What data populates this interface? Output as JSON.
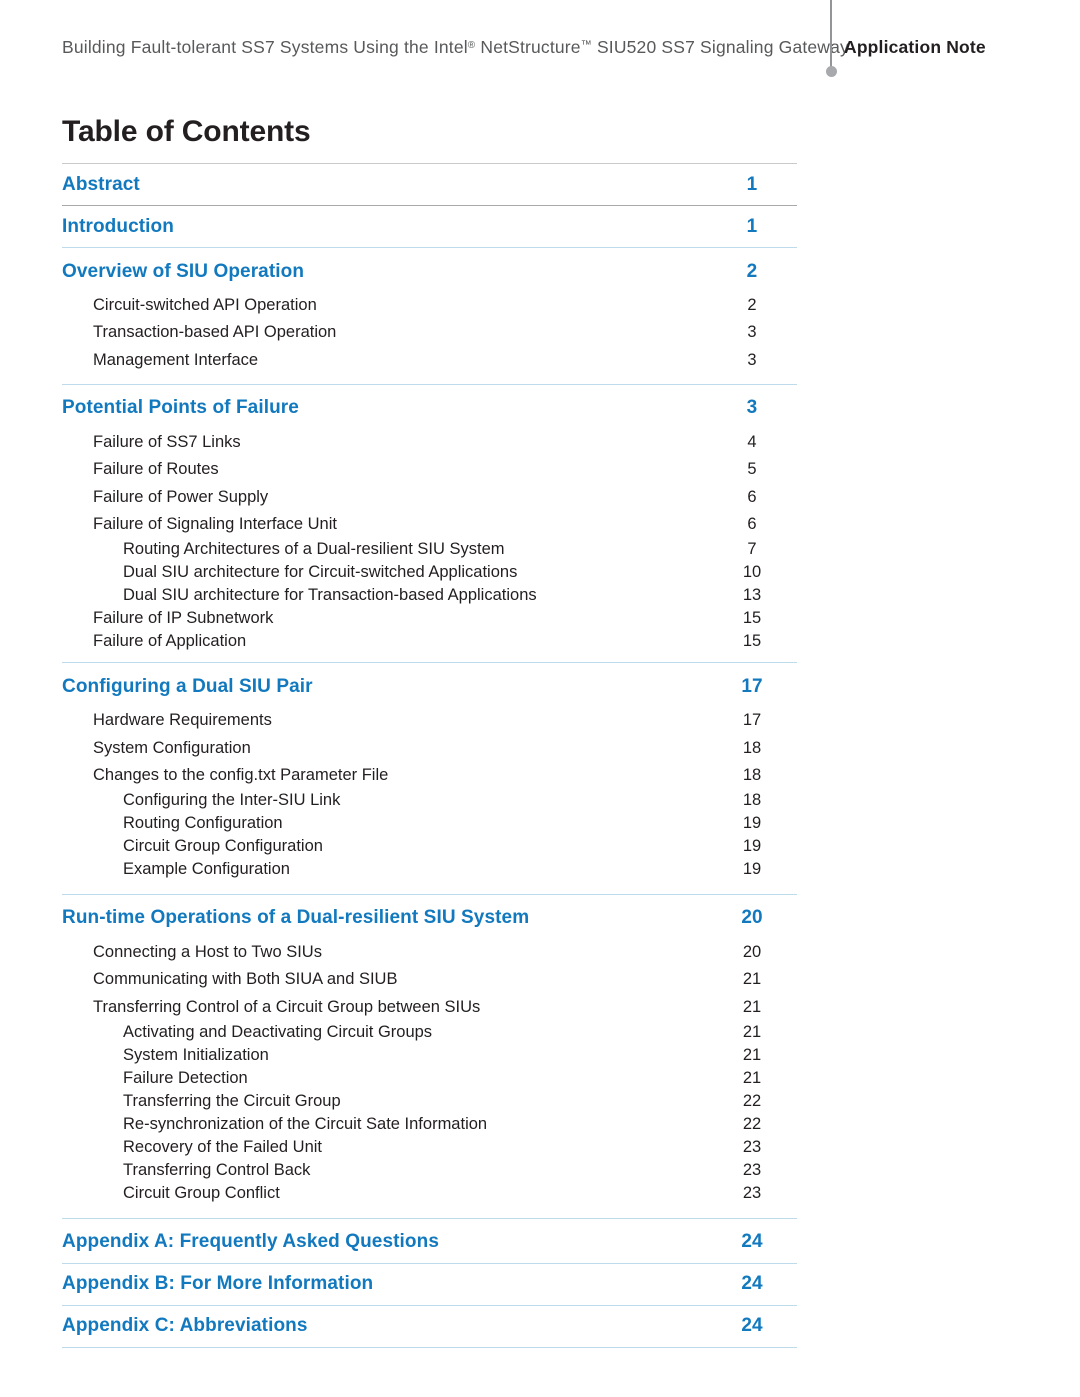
{
  "header": {
    "title_before_reg": "Building Fault-tolerant SS7 Systems Using the Intel",
    "reg_symbol": "®",
    "title_after_reg": " NetStructure",
    "tm_symbol": "™",
    "title_tail": " SIU520 SS7 Signaling Gateway",
    "kicker": "Application Note"
  },
  "page_title": "Table of Contents",
  "colors": {
    "heading_blue": "#1279be",
    "body_black": "#231f20",
    "rule_gray": "#a7a9ac",
    "rule_blue": "#bcdcec",
    "header_gray": "#58595b"
  },
  "toc": {
    "entries": [
      {
        "level": 1,
        "label": "Abstract",
        "page": "1"
      },
      {
        "level": 1,
        "label": "Introduction",
        "page": "1"
      },
      {
        "level": 1,
        "label": "Overview of SIU Operation",
        "page": "2"
      },
      {
        "level": 2,
        "label": "Circuit-switched API Operation",
        "page": "2"
      },
      {
        "level": 2,
        "label": "Transaction-based API Operation",
        "page": "3"
      },
      {
        "level": 2,
        "label": "Management Interface",
        "page": "3"
      },
      {
        "level": 1,
        "label": "Potential Points of Failure",
        "page": "3"
      },
      {
        "level": 2,
        "label": "Failure of SS7 Links",
        "page": "4"
      },
      {
        "level": 2,
        "label": "Failure of Routes",
        "page": "5"
      },
      {
        "level": 2,
        "label": "Failure of Power Supply",
        "page": "6"
      },
      {
        "level": 2,
        "label": "Failure of Signaling Interface Unit",
        "page": "6"
      },
      {
        "level": 3,
        "label": "Routing Architectures of a Dual-resilient SIU System",
        "page": "7"
      },
      {
        "level": 3,
        "label": "Dual SIU architecture for Circuit-switched Applications",
        "page": "10"
      },
      {
        "level": 3,
        "label": "Dual SIU architecture for Transaction-based Applications",
        "page": "13"
      },
      {
        "level": 2,
        "label": "Failure of IP Subnetwork",
        "page": "15"
      },
      {
        "level": 2,
        "label": "Failure of Application",
        "page": "15"
      },
      {
        "level": 1,
        "label": "Configuring a Dual SIU Pair",
        "page": "17"
      },
      {
        "level": 2,
        "label": "Hardware Requirements",
        "page": "17"
      },
      {
        "level": 2,
        "label": "System Configuration",
        "page": "18"
      },
      {
        "level": 2,
        "label": "Changes to the config.txt Parameter File",
        "page": "18"
      },
      {
        "level": 3,
        "label": "Configuring the Inter-SIU Link",
        "page": "18"
      },
      {
        "level": 3,
        "label": "Routing Configuration",
        "page": "19"
      },
      {
        "level": 3,
        "label": "Circuit Group Configuration",
        "page": "19"
      },
      {
        "level": 3,
        "label": "Example Configuration",
        "page": "19"
      },
      {
        "level": 1,
        "label": "Run-time Operations of a Dual-resilient SIU System",
        "page": "20"
      },
      {
        "level": 2,
        "label": "Connecting a Host to Two SIUs",
        "page": "20"
      },
      {
        "level": 2,
        "label": "Communicating with Both SIUA and SIUB",
        "page": "21"
      },
      {
        "level": 2,
        "label": "Transferring Control of a Circuit Group between SIUs",
        "page": "21"
      },
      {
        "level": 3,
        "label": "Activating and Deactivating Circuit Groups",
        "page": "21"
      },
      {
        "level": 3,
        "label": "System Initialization",
        "page": "21"
      },
      {
        "level": 3,
        "label": "Failure Detection",
        "page": "21"
      },
      {
        "level": 3,
        "label": "Transferring the Circuit Group",
        "page": "22"
      },
      {
        "level": 3,
        "label": "Re-synchronization of the Circuit Sate Information",
        "page": "22"
      },
      {
        "level": 3,
        "label": "Recovery of the Failed Unit",
        "page": "23"
      },
      {
        "level": 3,
        "label": "Transferring Control Back",
        "page": "23"
      },
      {
        "level": 3,
        "label": "Circuit Group Conflict",
        "page": "23"
      },
      {
        "level": 1,
        "label": "Appendix A: Frequently Asked Questions",
        "page": "24"
      },
      {
        "level": 1,
        "label": "Appendix B: For More Information",
        "page": "24"
      },
      {
        "level": 1,
        "label": "Appendix C: Abbreviations",
        "page": "24"
      }
    ]
  }
}
